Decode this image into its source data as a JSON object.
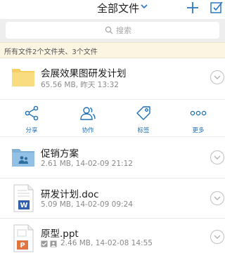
{
  "header": {
    "title": "全部文件",
    "title_chevron_icon": "chevron-down-icon",
    "add_icon": "plus-icon",
    "edit_icon": "edit-checkbox-icon"
  },
  "search": {
    "placeholder": "搜索",
    "icon": "search-icon"
  },
  "summary": "所有文件2个文件夹、3个文件",
  "files": [
    {
      "name": "会展效果图研发计划",
      "size": "65.56 MB,",
      "date": "昨天 13:32",
      "icon": "folder-icon"
    },
    {
      "name": "促销方案",
      "size": "2.61 MB,",
      "date": "14-02-09  21:12",
      "icon": "shared-folder-icon"
    },
    {
      "name": "研发计划.doc",
      "size": "5.09 MB,",
      "date": "14-02-09  09:24",
      "icon": "word-file-icon"
    },
    {
      "name": "原型.ppt",
      "size": "2.46 MB,",
      "date": "14-02-08  14:55",
      "icon": "ppt-file-icon"
    }
  ],
  "actions": [
    {
      "label": "分享",
      "icon": "share-icon"
    },
    {
      "label": "协作",
      "icon": "collaborate-icon"
    },
    {
      "label": "标签",
      "icon": "tag-icon"
    },
    {
      "label": "更多",
      "icon": "more-icon"
    }
  ],
  "colors": {
    "accent": "#1d6fb8",
    "summary_bg": "#fbf5e2",
    "folder": "#f8d978"
  }
}
